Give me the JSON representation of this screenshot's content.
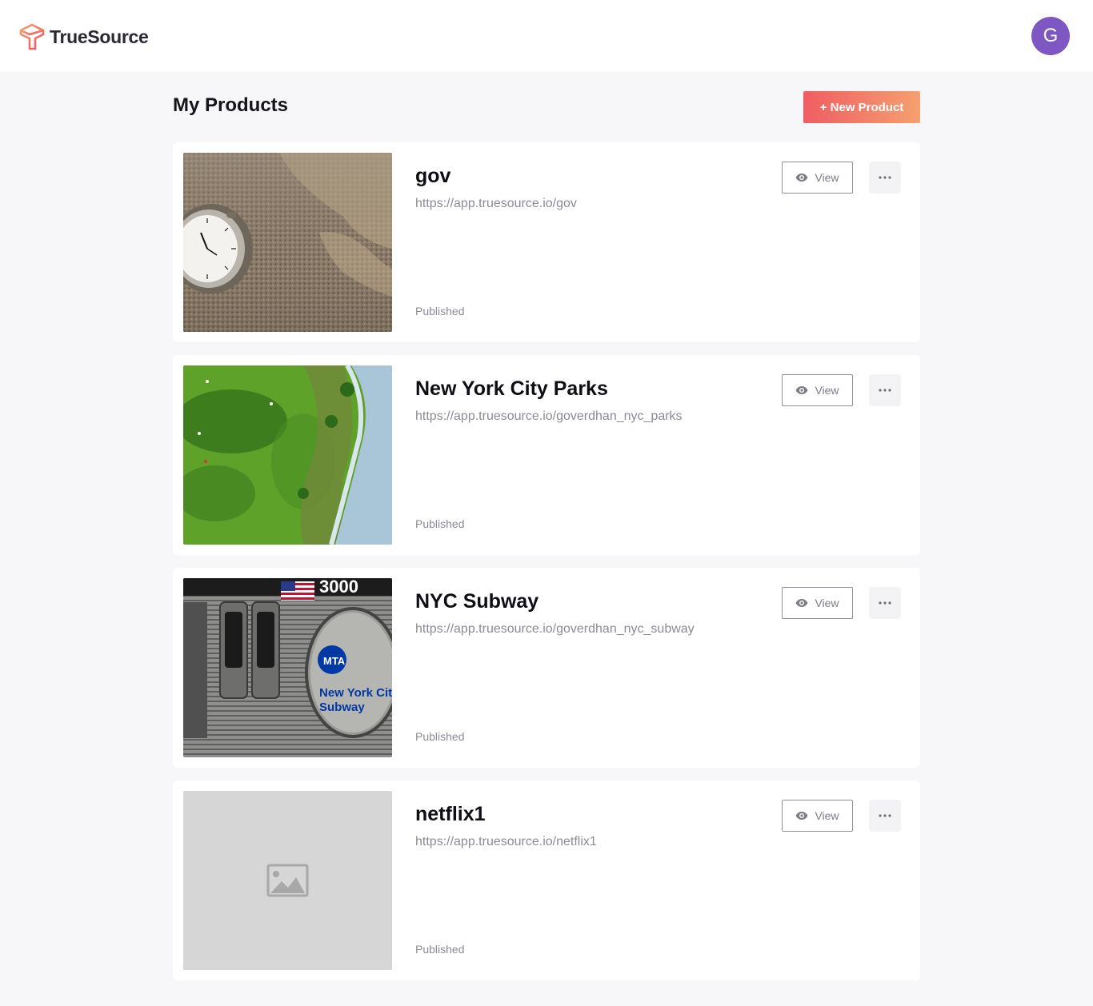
{
  "header": {
    "brand": "TrueSource",
    "user_initial": "G",
    "brand_color_start": "#ef5d63",
    "brand_color_end": "#f5a06f",
    "avatar_color": "#7e57c2"
  },
  "page": {
    "title": "My Products",
    "new_button_label": "+ New Product"
  },
  "products": [
    {
      "title": "gov",
      "url": "https://app.truesource.io/gov",
      "status": "Published",
      "view_label": "View",
      "thumbnail": "pocket-watch-on-map-photo"
    },
    {
      "title": "New York City Parks",
      "url": "https://app.truesource.io/goverdhan_nyc_parks",
      "status": "Published",
      "view_label": "View",
      "thumbnail": "aerial-park-photo"
    },
    {
      "title": "NYC Subway",
      "url": "https://app.truesource.io/goverdhan_nyc_subway",
      "status": "Published",
      "view_label": "View",
      "thumbnail": "subway-car-photo",
      "thumbnail_text": [
        "MTA",
        "New York City",
        "Subway",
        "3000"
      ]
    },
    {
      "title": "netflix1",
      "url": "https://app.truesource.io/netflix1",
      "status": "Published",
      "view_label": "View",
      "thumbnail": "image-placeholder-icon"
    }
  ]
}
